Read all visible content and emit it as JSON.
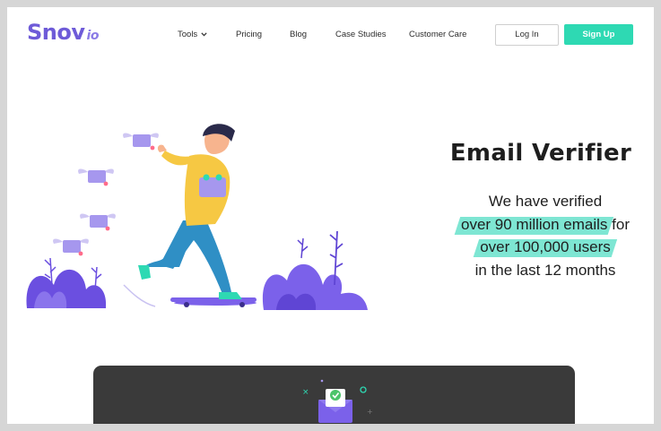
{
  "header": {
    "logo_main": "Snov",
    "logo_suffix": "io",
    "nav": [
      {
        "label": "Tools"
      },
      {
        "label": "Pricing"
      },
      {
        "label": "Blog"
      },
      {
        "label": "Case Studies"
      },
      {
        "label": "Customer Care"
      }
    ],
    "login_label": "Log In",
    "signup_label": "Sign Up"
  },
  "hero": {
    "title": "Email Verifier",
    "line1": "We have verified",
    "line2_highlight": "over 90 million emails",
    "line2_tail": " for",
    "line3_highlight": "over 100,000 users",
    "line4": "in the last 12 months"
  },
  "colors": {
    "brand": "#6e5bd8",
    "accent": "#2ed9b3",
    "highlight": "#7ee6d3",
    "card_bg": "#3a3a3a"
  },
  "icons": [
    "chevron-down-icon",
    "mail-check-icon"
  ]
}
